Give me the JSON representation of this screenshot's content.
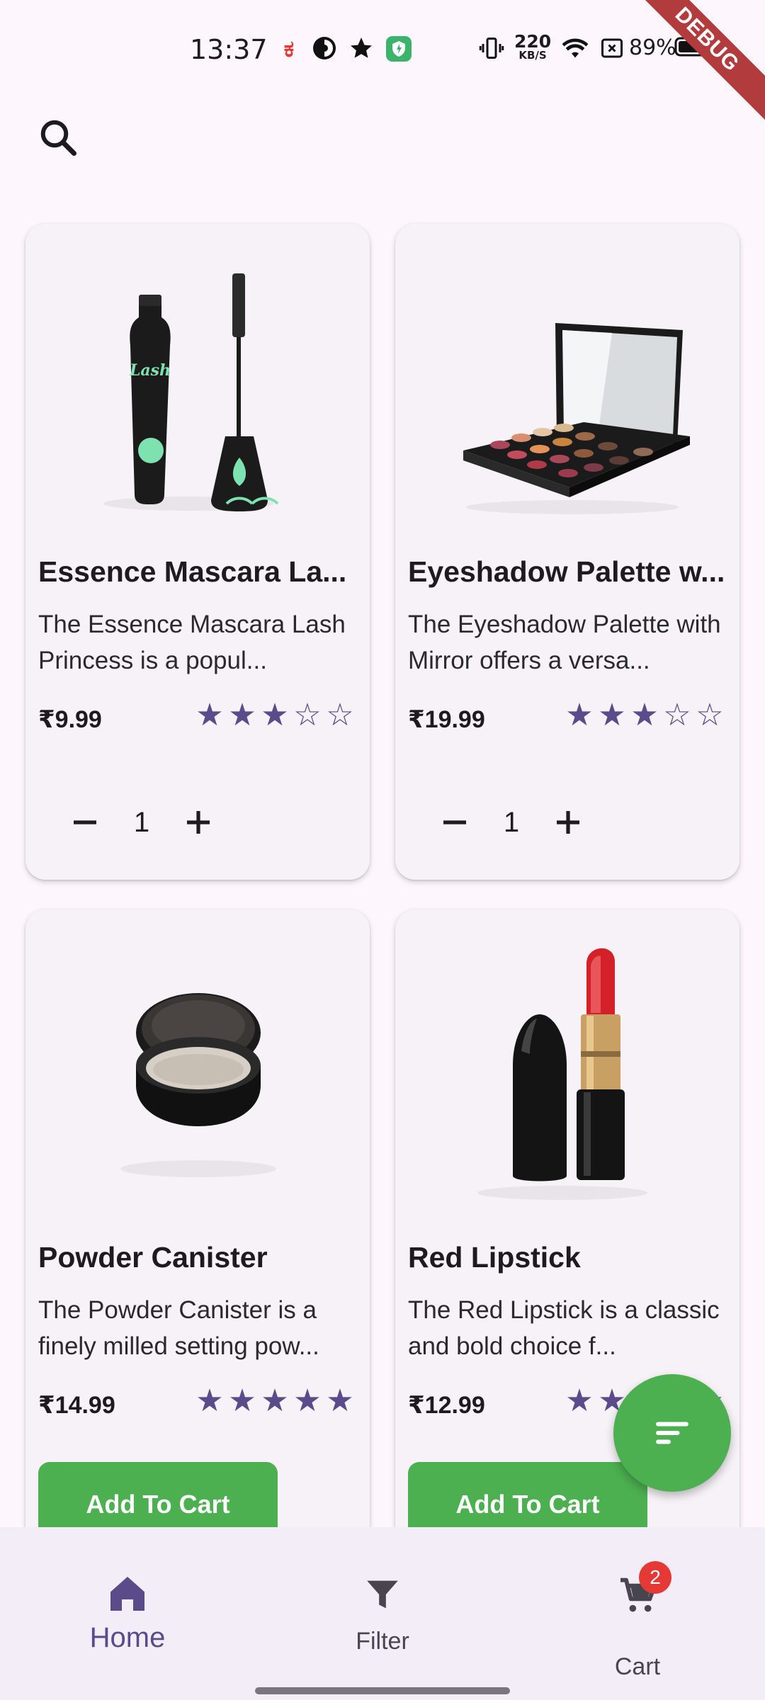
{
  "status_bar": {
    "time": "13:37",
    "net_speed_value": "220",
    "net_speed_unit": "KB/S",
    "battery": "89%",
    "debug_label": "DEBUG"
  },
  "search": {
    "icon": "search-icon"
  },
  "products": [
    {
      "name": "Essence Mascara La...",
      "description": "The Essence Mascara Lash Princess is a popul...",
      "price": "₹9.99",
      "rating_stars": 3,
      "quantity": "1",
      "action": "quantity"
    },
    {
      "name": "Eyeshadow Palette w...",
      "description": "The Eyeshadow Palette with Mirror offers a versa...",
      "price": "₹19.99",
      "rating_stars": 3,
      "quantity": "1",
      "action": "quantity"
    },
    {
      "name": "Powder Canister",
      "description": "The Powder Canister is a finely milled setting pow...",
      "price": "₹14.99",
      "rating_stars": 5,
      "add_to_cart_label": "Add To Cart",
      "action": "add"
    },
    {
      "name": "Red Lipstick",
      "description": "The Red Lipstick is a classic and bold choice f...",
      "price": "₹12.99",
      "rating_stars": 5,
      "add_to_cart_label": "Add To Cart",
      "action": "add"
    }
  ],
  "fab": {
    "icon": "sort-icon"
  },
  "bottom_nav": {
    "home_label": "Home",
    "filter_label": "Filter",
    "cart_label": "Cart",
    "cart_badge": "2"
  },
  "colors": {
    "accent": "#4caf50",
    "star": "#5b4b8a",
    "nav_active": "#5b4b8a",
    "badge": "#e53935"
  }
}
